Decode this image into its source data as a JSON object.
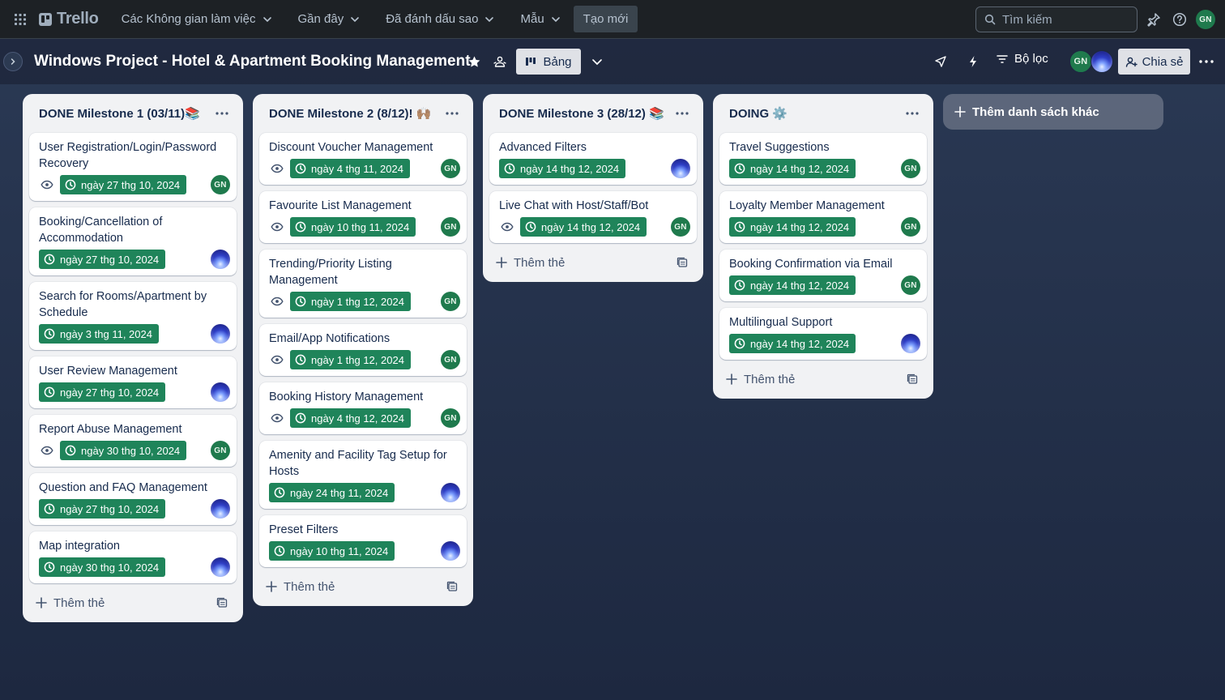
{
  "nav": {
    "logo": "Trello",
    "workspaces": "Các Không gian làm việc",
    "recent": "Gần đây",
    "starred": "Đã đánh dấu sao",
    "templates": "Mẫu",
    "create": "Tạo mới",
    "search_placeholder": "Tìm kiếm",
    "user_initials": "GN"
  },
  "board": {
    "title": "Windows Project - Hotel & Apartment Booking Management",
    "view_label": "Bảng",
    "filter_label": "Bộ lọc",
    "share_label": "Chia sẻ",
    "member_initials": "GN"
  },
  "lists": [
    {
      "title": "DONE Milestone 1 (03/11)📚",
      "add_card": "Thêm thẻ",
      "cards": [
        {
          "title": "User Registration/Login/Password Recovery",
          "watch": true,
          "due": "ngày 27 thg 10, 2024",
          "member": "GN"
        },
        {
          "title": "Booking/Cancellation of Accommodation",
          "watch": false,
          "due": "ngày 27 thg 10, 2024",
          "member": "img"
        },
        {
          "title": "Search for Rooms/Apartment by Schedule",
          "watch": false,
          "due": "ngày 3 thg 11, 2024",
          "member": "img"
        },
        {
          "title": "User Review Management",
          "watch": false,
          "due": "ngày 27 thg 10, 2024",
          "member": "img"
        },
        {
          "title": "Report Abuse Management",
          "watch": true,
          "due": "ngày 30 thg 10, 2024",
          "member": "GN"
        },
        {
          "title": "Question and FAQ Management",
          "watch": false,
          "due": "ngày 27 thg 10, 2024",
          "member": "img"
        },
        {
          "title": "Map integration",
          "watch": false,
          "due": "ngày 30 thg 10, 2024",
          "member": "img"
        }
      ]
    },
    {
      "title": "DONE Milestone 2 (8/12)! 🙌🏽",
      "add_card": "Thêm thẻ",
      "cards": [
        {
          "title": "Discount Voucher Management",
          "watch": true,
          "due": "ngày 4 thg 11, 2024",
          "member": "GN"
        },
        {
          "title": "Favourite List Management",
          "watch": true,
          "due": "ngày 10 thg 11, 2024",
          "member": "GN"
        },
        {
          "title": "Trending/Priority Listing Management",
          "watch": true,
          "due": "ngày 1 thg 12, 2024",
          "member": "GN"
        },
        {
          "title": "Email/App Notifications",
          "watch": true,
          "due": "ngày 1 thg 12, 2024",
          "member": "GN"
        },
        {
          "title": "Booking History Management",
          "watch": true,
          "due": "ngày 4 thg 12, 2024",
          "member": "GN"
        },
        {
          "title": "Amenity and Facility Tag Setup for Hosts",
          "watch": false,
          "due": "ngày 24 thg 11, 2024",
          "member": "img"
        },
        {
          "title": "Preset Filters",
          "watch": false,
          "due": "ngày 10 thg 11, 2024",
          "member": "img"
        }
      ]
    },
    {
      "title": "DONE Milestone 3 (28/12) 📚",
      "add_card": "Thêm thẻ",
      "cards": [
        {
          "title": "Advanced Filters",
          "watch": false,
          "due": "ngày 14 thg 12, 2024",
          "member": "img"
        },
        {
          "title": "Live Chat with Host/Staff/Bot",
          "watch": true,
          "due": "ngày 14 thg 12, 2024",
          "member": "GN"
        }
      ]
    },
    {
      "title": "DOING ⚙️",
      "add_card": "Thêm thẻ",
      "cards": [
        {
          "title": "Travel Suggestions",
          "watch": false,
          "due": "ngày 14 thg 12, 2024",
          "member": "GN"
        },
        {
          "title": "Loyalty Member Management",
          "watch": false,
          "due": "ngày 14 thg 12, 2024",
          "member": "GN"
        },
        {
          "title": "Booking Confirmation via Email",
          "watch": false,
          "due": "ngày 14 thg 12, 2024",
          "member": "GN"
        },
        {
          "title": "Multilingual Support",
          "watch": false,
          "due": "ngày 14 thg 12, 2024",
          "member": "img"
        }
      ]
    }
  ],
  "add_list": "Thêm danh sách khác",
  "colors": {
    "due_badge": "#1f845a",
    "member_avatar": "#1f7a4d",
    "nav_bg": "#1d2125",
    "list_bg": "#f1f2f4"
  }
}
